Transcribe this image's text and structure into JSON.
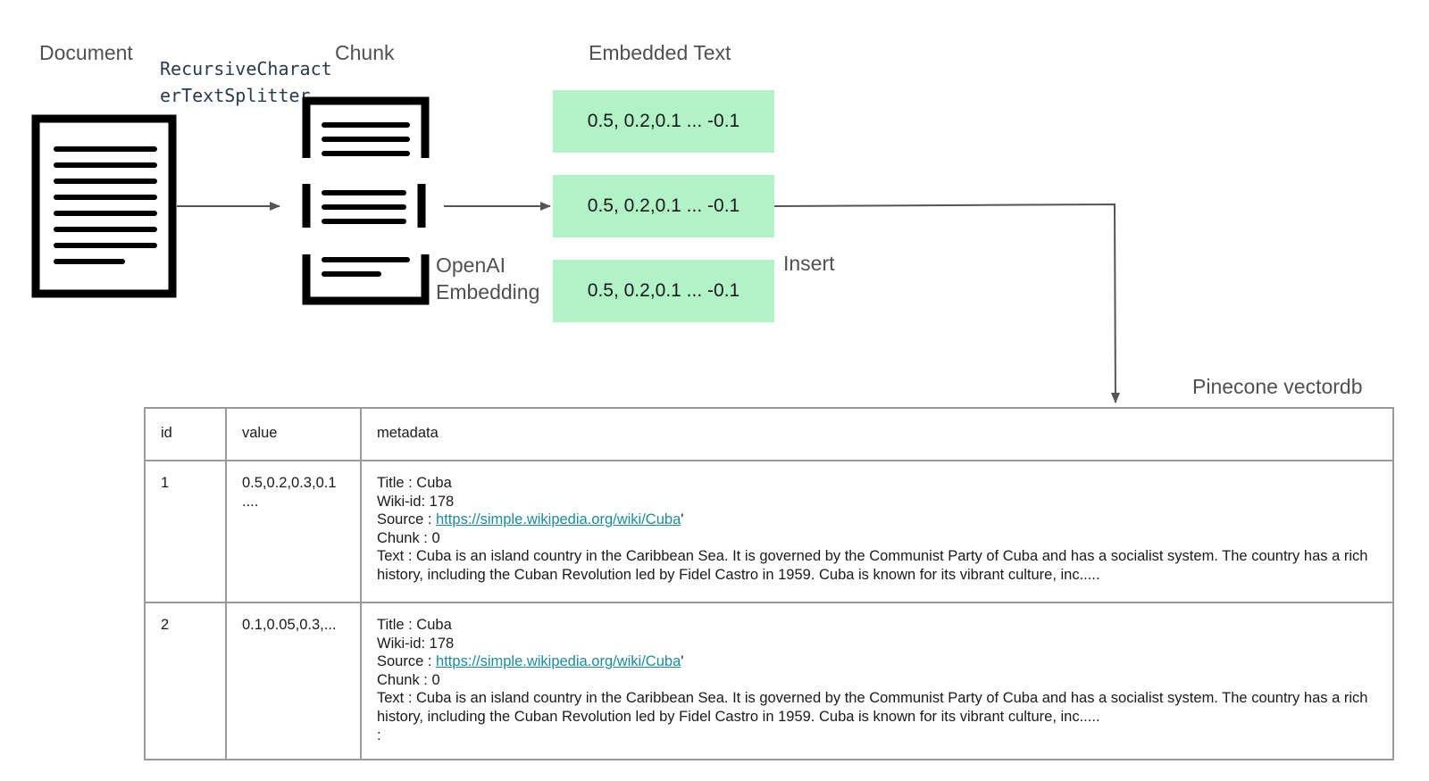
{
  "stages": {
    "document": "Document",
    "chunk": "Chunk",
    "embedded_text": "Embedded Text",
    "splitter_line1": "RecursiveCharact",
    "splitter_line2": "erTextSplitter",
    "embedding_line1": "OpenAI",
    "embedding_line2": "Embedding",
    "insert": "Insert",
    "vectordb": "Pinecone vectordb"
  },
  "embeddings": [
    "0.5, 0.2,0.1 ... -0.1",
    "0.5, 0.2,0.1 ... -0.1",
    "0.5, 0.2,0.1 ... -0.1"
  ],
  "colors": {
    "embedding_box": "#b2f2c7",
    "link": "#1a8c9c",
    "table_border": "#9a9a9a",
    "arrow": "#555555"
  },
  "table": {
    "headers": [
      "id",
      "value",
      "metadata"
    ],
    "rows": [
      {
        "id": "1",
        "value_line1": "0.5,0.2,0.3,0.1",
        "value_line2": "....",
        "title": "Title : Cuba",
        "wiki_id": "Wiki-id: 178",
        "source_label": "Source : ",
        "source_url": "https://simple.wikipedia.org/wiki/Cuba",
        "source_suffix": "'",
        "chunk": "Chunk : 0",
        "text": "Text : Cuba is an island country in the Caribbean Sea. It is governed by the Communist Party of Cuba and has a socialist system. The country has a rich history, including the Cuban Revolution led by Fidel Castro in 1959. Cuba is known for its vibrant culture, inc.....",
        "extra": ""
      },
      {
        "id": "2",
        "value_line1": "0.1,0.05,0.3,...",
        "value_line2": "",
        "title": "Title : Cuba",
        "wiki_id": "Wiki-id: 178",
        "source_label": "Source : ",
        "source_url": "https://simple.wikipedia.org/wiki/Cuba",
        "source_suffix": "'",
        "chunk": "Chunk : 0",
        "text": "Text : Cuba is an island country in the Caribbean Sea. It is governed by the Communist Party of Cuba and has a socialist system. The country has a rich history, including the Cuban Revolution led by Fidel Castro in 1959. Cuba is known for its vibrant culture, inc.....",
        "extra": ":"
      }
    ]
  }
}
